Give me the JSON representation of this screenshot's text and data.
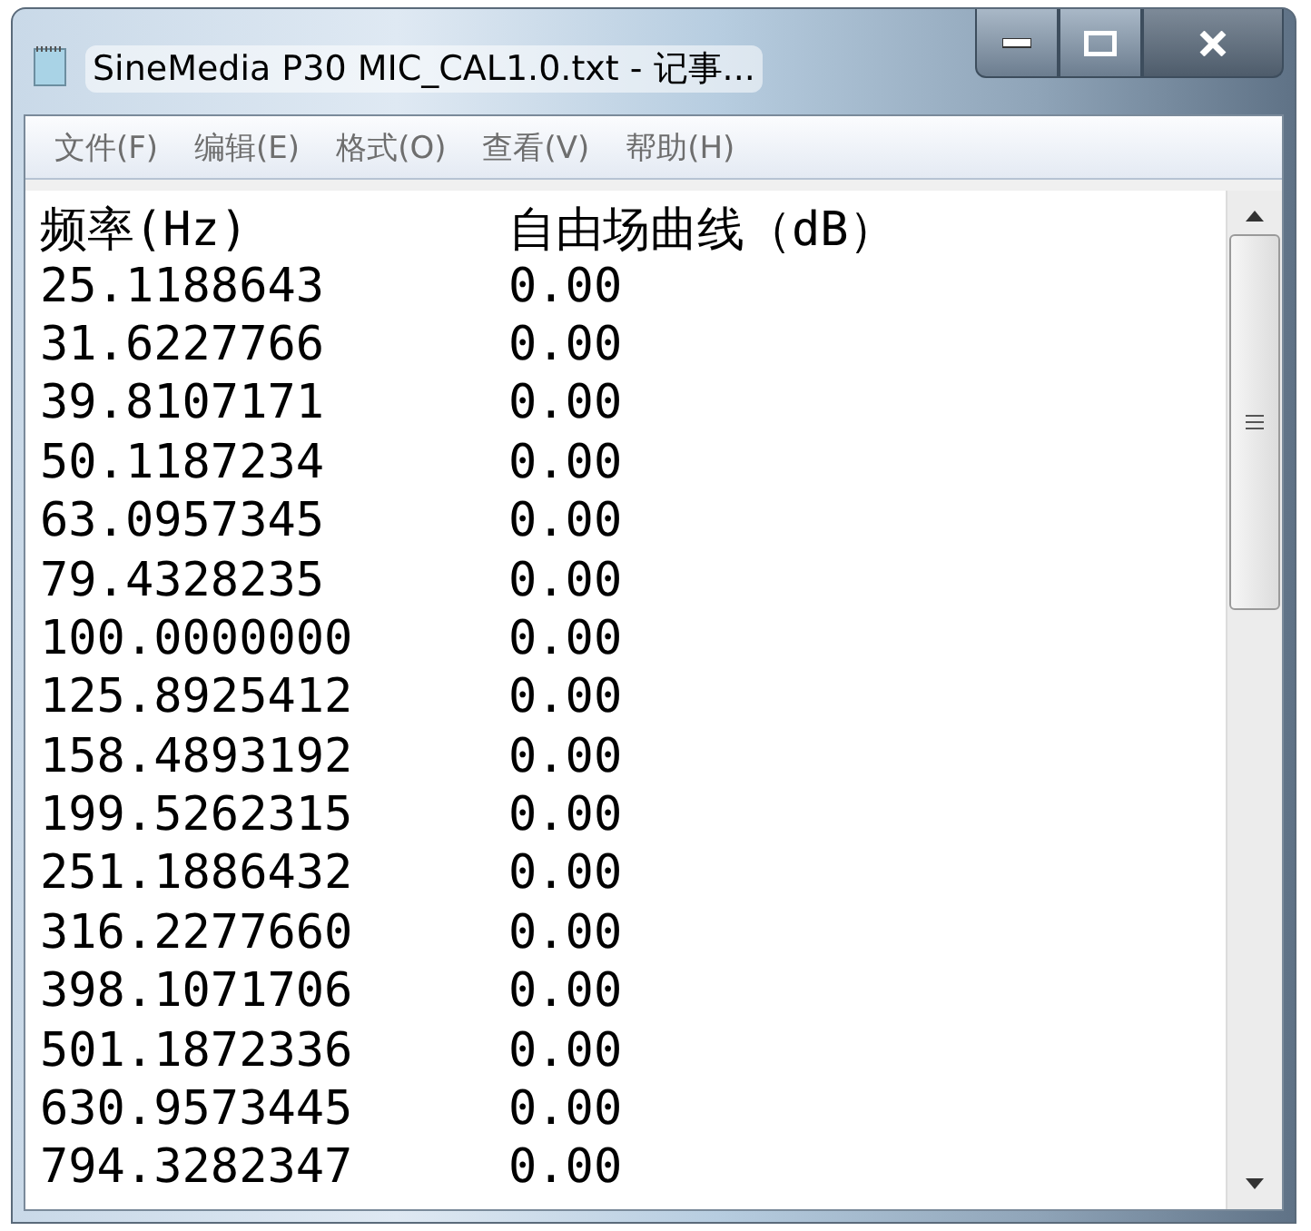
{
  "window": {
    "title": "SineMedia P30 MIC_CAL1.0.txt - 记事..."
  },
  "menu": [
    "文件(F)",
    "编辑(E)",
    "格式(O)",
    "查看(V)",
    "帮助(H)"
  ],
  "lines": [
    [
      "频率(Hz)",
      "自由场曲线（dB）"
    ],
    [
      "25.1188643",
      "0.00"
    ],
    [
      "31.6227766",
      "0.00"
    ],
    [
      "39.8107171",
      "0.00"
    ],
    [
      "50.1187234",
      "0.00"
    ],
    [
      "63.0957345",
      "0.00"
    ],
    [
      "79.4328235",
      "0.00"
    ],
    [
      "100.0000000",
      "0.00"
    ],
    [
      "125.8925412",
      "0.00"
    ],
    [
      "158.4893192",
      "0.00"
    ],
    [
      "199.5262315",
      "0.00"
    ],
    [
      "251.1886432",
      "0.00"
    ],
    [
      "316.2277660",
      "0.00"
    ],
    [
      "398.1071706",
      "0.00"
    ],
    [
      "501.1872336",
      "0.00"
    ],
    [
      "630.9573445",
      "0.00"
    ],
    [
      "794.3282347",
      "0.00"
    ]
  ]
}
